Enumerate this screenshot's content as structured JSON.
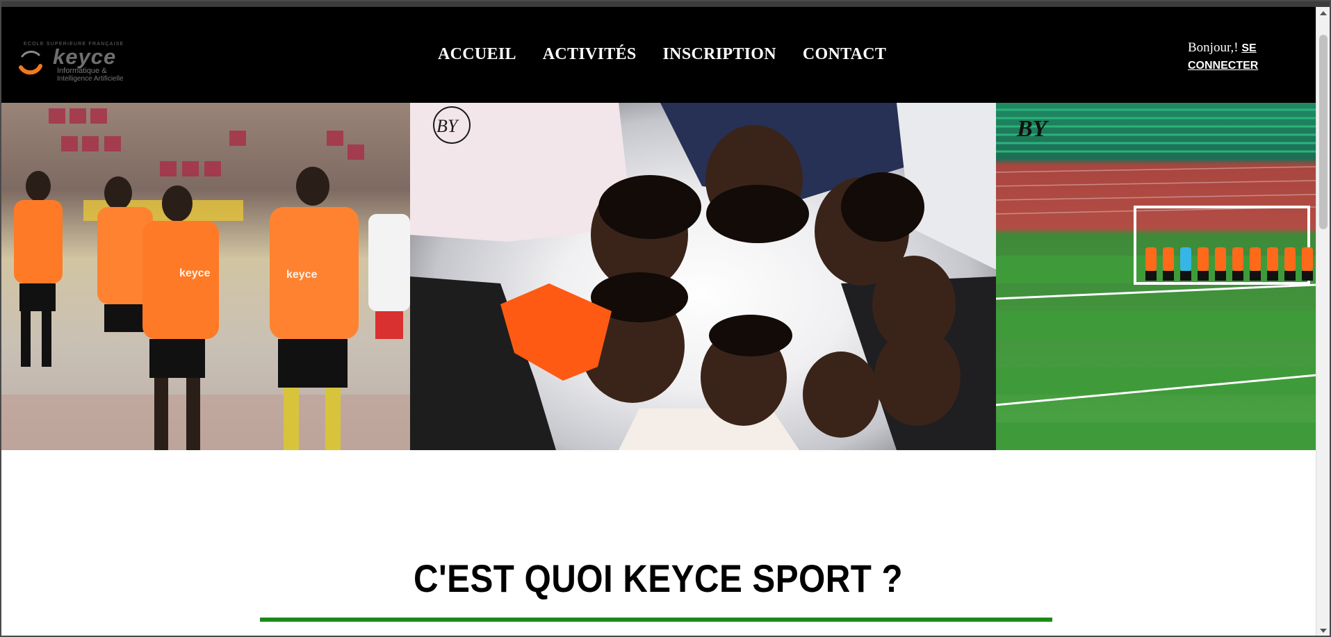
{
  "logo": {
    "tagline": "ECOLE SUPERIEURE FRANÇAISE",
    "brand": "keyce",
    "line1": "Informatique &",
    "line2": "Intelligence Artificielle"
  },
  "nav": [
    {
      "label": "ACCUEIL"
    },
    {
      "label": "ACTIVITÉS"
    },
    {
      "label": "INSCRIPTION"
    },
    {
      "label": "CONTACT"
    }
  ],
  "user": {
    "greeting": "Bonjour,!",
    "login_label": "SE CONNECTER"
  },
  "hero": {
    "photos": [
      {
        "alt": "Players in orange jerseys walking onto the pitch"
      },
      {
        "alt": "Team huddle viewed from below"
      },
      {
        "alt": "Team lined up in front of the goal"
      }
    ],
    "watermark": "BY"
  },
  "section": {
    "title": "C'EST QUOI KEYCE SPORT ?"
  },
  "colors": {
    "header_bg": "#000000",
    "accent_orange": "#ff7a1a",
    "rule_green": "#1a8a1a"
  }
}
